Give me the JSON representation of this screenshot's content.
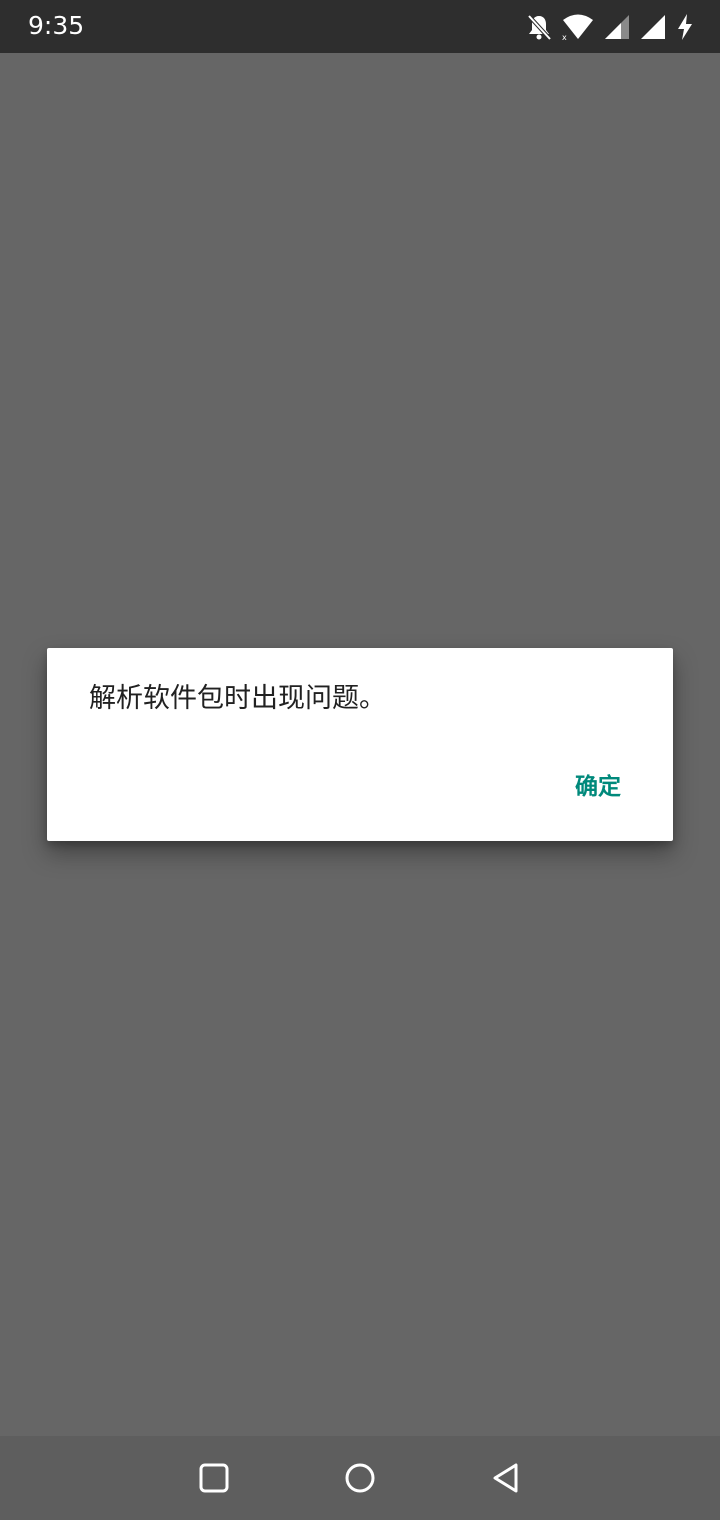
{
  "status_bar": {
    "time": "9:35",
    "icons": [
      "bell-off-icon",
      "wifi-icon",
      "signal-icon",
      "signal-icon",
      "charging-icon"
    ]
  },
  "dialog": {
    "message": "解析软件包时出现问题。",
    "ok_label": "确定"
  },
  "nav_bar": {
    "buttons": [
      "recents",
      "home",
      "back"
    ]
  },
  "colors": {
    "background": "#666666",
    "status_bar": "#2e2e2e",
    "nav_bar": "#5e5e5e",
    "accent": "#00897b",
    "dialog": "#ffffff"
  }
}
